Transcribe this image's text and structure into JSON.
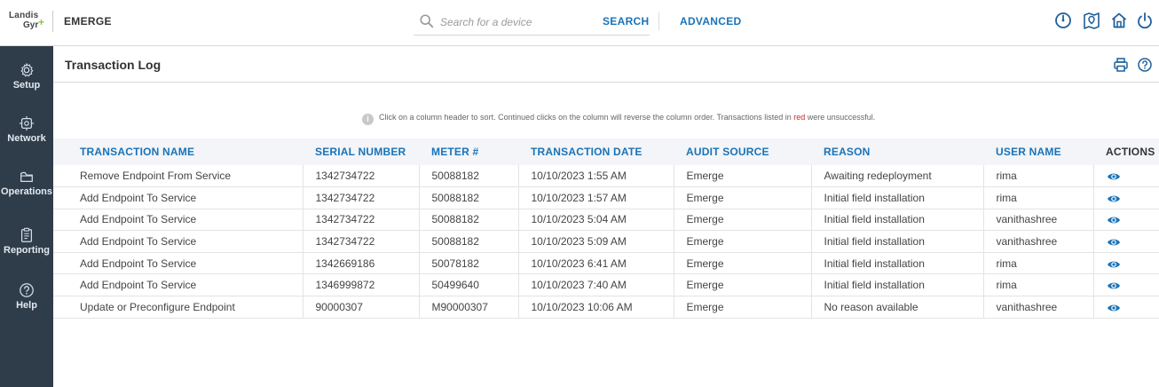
{
  "brand": {
    "logo_line1": "Landis",
    "logo_line2": "Gyr",
    "logo_plus": "+",
    "app_name": "EMERGE"
  },
  "search": {
    "placeholder": "Search for a device",
    "search_label": "SEARCH",
    "advanced_label": "ADVANCED"
  },
  "top_icons": [
    "dashboard-gauge-icon",
    "map-pin-icon",
    "home-icon",
    "power-icon"
  ],
  "sidebar": {
    "items": [
      {
        "label": "Setup",
        "icon": "gear-icon"
      },
      {
        "label": "Network",
        "icon": "network-icon"
      },
      {
        "label": "Operations",
        "icon": "folder-icon"
      },
      {
        "label": "Reporting",
        "icon": "report-icon"
      },
      {
        "label": "Help",
        "icon": "help-icon"
      }
    ]
  },
  "page": {
    "title": "Transaction Log",
    "info_text_1": "Click on a column header to sort. Continued clicks on the column will reverse the column order. Transactions listed in ",
    "info_red": "red",
    "info_text_2": " were unsuccessful."
  },
  "table": {
    "headers": [
      "TRANSACTION NAME",
      "SERIAL NUMBER",
      "METER #",
      "TRANSACTION DATE",
      "AUDIT SOURCE",
      "REASON",
      "USER NAME",
      "ACTIONS"
    ],
    "rows": [
      [
        "Remove Endpoint From Service",
        "1342734722",
        "50088182",
        "10/10/2023 1:55 AM",
        "Emerge",
        "Awaiting redeployment",
        "rima"
      ],
      [
        "Add Endpoint To Service",
        "1342734722",
        "50088182",
        "10/10/2023 1:57 AM",
        "Emerge",
        "Initial field installation",
        "rima"
      ],
      [
        "Add Endpoint To Service",
        "1342734722",
        "50088182",
        "10/10/2023 5:04 AM",
        "Emerge",
        "Initial field installation",
        "vanithashree"
      ],
      [
        "Add Endpoint To Service",
        "1342734722",
        "50088182",
        "10/10/2023 5:09 AM",
        "Emerge",
        "Initial field installation",
        "vanithashree"
      ],
      [
        "Add Endpoint To Service",
        "1342669186",
        "50078182",
        "10/10/2023 6:41 AM",
        "Emerge",
        "Initial field installation",
        "rima"
      ],
      [
        "Add Endpoint To Service",
        "1346999872",
        "50499640",
        "10/10/2023 7:40 AM",
        "Emerge",
        "Initial field installation",
        "rima"
      ],
      [
        "Update or Preconfigure Endpoint",
        "90000307",
        "M90000307",
        "10/10/2023 10:06 AM",
        "Emerge",
        "No reason available",
        "vanithashree"
      ]
    ]
  },
  "colors": {
    "sidebar_bg": "#2f3d4b",
    "accent_blue": "#1a73b8",
    "error_red": "#d0262b",
    "header_row_bg": "#f3f5f8"
  }
}
